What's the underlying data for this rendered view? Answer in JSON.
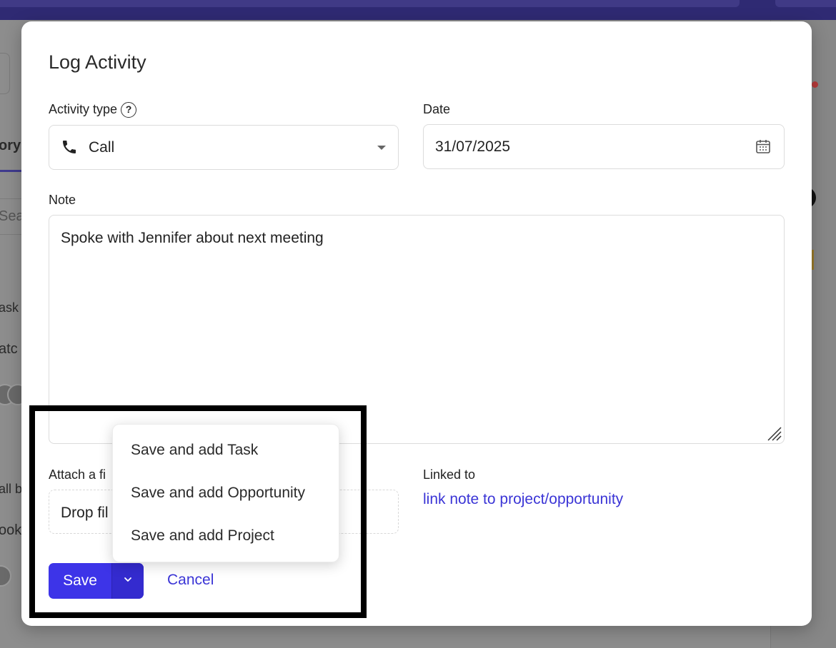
{
  "modal": {
    "title": "Log Activity",
    "activity_type": {
      "label": "Activity type",
      "help": "?",
      "value": "Call",
      "icon": "phone-icon"
    },
    "date": {
      "label": "Date",
      "value": "31/07/2025",
      "icon": "calendar-icon"
    },
    "note": {
      "label": "Note",
      "value": "Spoke with Jennifer about next meeting"
    },
    "attach": {
      "label": "Attach a fi",
      "drop_text": "Drop fil"
    },
    "linked": {
      "label": "Linked to",
      "link_text": "link note to project/opportunity"
    },
    "actions": {
      "save_label": "Save",
      "cancel_label": "Cancel"
    },
    "save_menu": {
      "items": [
        "Save and add Task",
        "Save and add Opportunity",
        "Save and add Project"
      ]
    }
  },
  "background": {
    "fragments": [
      "ory",
      "Sea",
      "ask",
      "atc",
      "all b",
      "ook"
    ]
  },
  "colors": {
    "accent": "#3d34e8",
    "link": "#3b35d6",
    "topbar": "#2f2a73"
  }
}
